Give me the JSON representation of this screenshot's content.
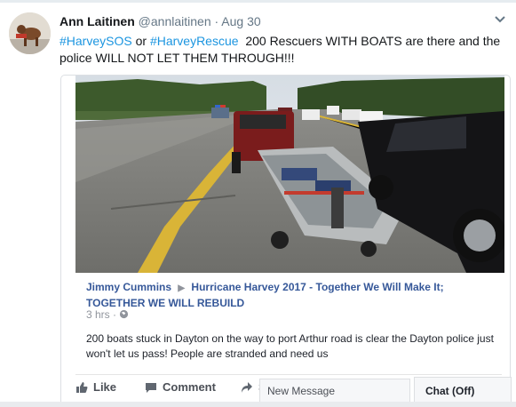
{
  "tweet": {
    "display_name": "Ann Laitinen",
    "handle": "@annlaitinen",
    "separator": "·",
    "date": "Aug 30",
    "hashtag_1": "#HarveySOS",
    "connector": "or",
    "hashtag_2": "#HarveyRescue",
    "body": "200 Rescuers WITH BOATS are there and the police WILL NOT LET THEM THROUGH!!!"
  },
  "card": {
    "author": "Jimmy Cummins",
    "arrow": "▶",
    "page": "Hurricane Harvey 2017 - Together We Will Make It; TOGETHER WE WILL REBUILD",
    "time": "3 hrs ·",
    "text": "200 boats stuck in Dayton on the way to port Arthur road is clear the Dayton police just won't let us pass! People are stranded and need us",
    "actions": {
      "like": "Like",
      "comment": "Comment",
      "share": "S"
    }
  },
  "chat": {
    "new_message": "New Message",
    "chat_status": "Chat (Off)"
  },
  "icons": [
    "chevron-down-icon",
    "globe-icon",
    "like-icon",
    "comment-icon",
    "share-icon"
  ],
  "colors": {
    "link": "#1b95e0",
    "fb_blue": "#365899",
    "text": "#14171a",
    "muted": "#657786"
  }
}
